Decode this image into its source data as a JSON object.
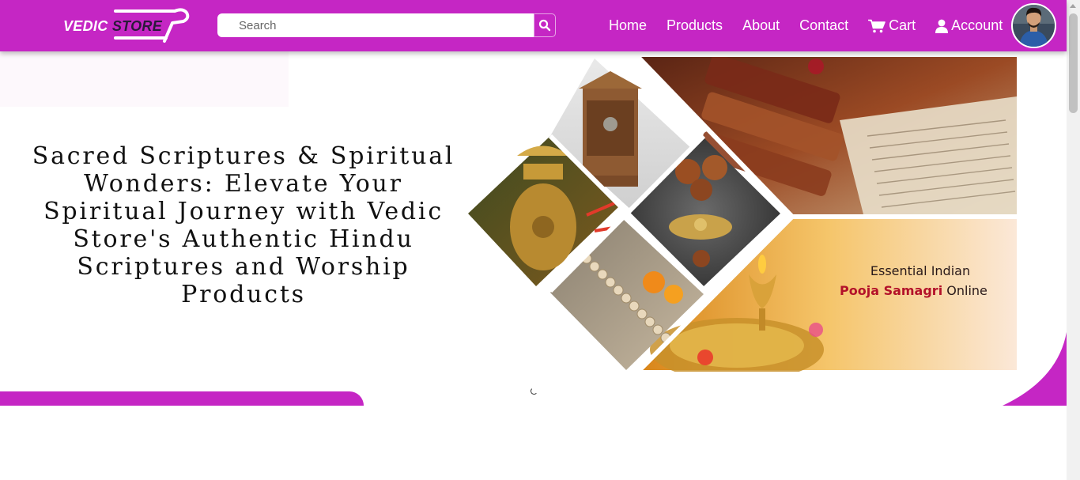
{
  "header": {
    "logo": {
      "text_primary": "VEDIC",
      "text_secondary": "STORE"
    },
    "search": {
      "placeholder": "Search",
      "value": ""
    },
    "nav": [
      {
        "label": "Home"
      },
      {
        "label": "Products"
      },
      {
        "label": "About"
      },
      {
        "label": "Contact"
      },
      {
        "label": "Cart",
        "icon": "cart-icon"
      },
      {
        "label": "Account",
        "icon": "user-icon"
      }
    ],
    "avatar_icon": "user-avatar"
  },
  "hero": {
    "headline": "Sacred Scriptures & Spiritual Wonders: Elevate Your Spiritual Journey with Vedic Store's Authentic Hindu Scriptures and Worship Products",
    "banner_line1": "Essential Indian",
    "banner_line2_highlight": "Pooja Samagri",
    "banner_line2_rest": " Online"
  },
  "colors": {
    "brand": "#c526c4",
    "text": "#111111",
    "banner_highlight": "#b3122a"
  }
}
